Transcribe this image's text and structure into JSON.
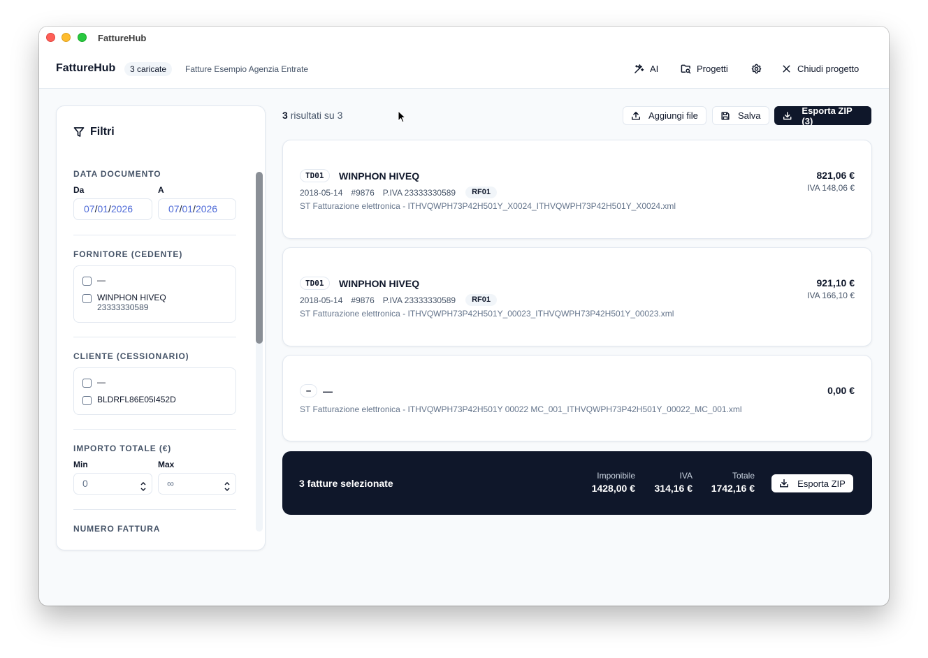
{
  "window": {
    "title": "FattureHub"
  },
  "header": {
    "brand": "FattureHub",
    "loaded_badge": "3 caricate",
    "project_name": "Fatture Esempio Agenzia Entrate",
    "ai_label": "AI",
    "projects_label": "Progetti",
    "close_project_label": "Chiudi progetto"
  },
  "sidebar": {
    "title": "Filtri",
    "date_section": {
      "title": "DATA DOCUMENTO",
      "from_label": "Da",
      "to_label": "A",
      "from": {
        "day": "07",
        "month": "01",
        "year": "2026"
      },
      "to": {
        "day": "07",
        "month": "01",
        "year": "2026"
      }
    },
    "supplier_section": {
      "title": "FORNITORE (CEDENTE)",
      "options": [
        {
          "label": "—",
          "sub": ""
        },
        {
          "label": "WINPHON HIVEQ",
          "sub": "23333330589"
        }
      ]
    },
    "client_section": {
      "title": "CLIENTE (CESSIONARIO)",
      "options": [
        {
          "label": "—"
        },
        {
          "label": "BLDRFL86E05I452D"
        }
      ]
    },
    "amount_section": {
      "title": "IMPORTO TOTALE (€)",
      "min_label": "Min",
      "max_label": "Max",
      "min_placeholder": "0",
      "max_placeholder": "∞"
    },
    "number_section": {
      "title": "NUMERO FATTURA"
    }
  },
  "results": {
    "count_shown": "3",
    "count_text": "risultati su 3",
    "add_files_label": "Aggiungi file",
    "save_label": "Salva",
    "export_zip_label": "Esporta ZIP (3)"
  },
  "invoices": [
    {
      "doc_type": "TD01",
      "supplier": "WINPHON HIVEQ",
      "date": "2018-05-14",
      "number": "#9876",
      "vat_id": "P.IVA 23333330589",
      "regime": "RF01",
      "file": "ST Fatturazione elettronica - ITHVQWPH73P42H501Y_X0024_ITHVQWPH73P42H501Y_X0024.xml",
      "amount": "821,06 €",
      "vat": "IVA 148,06 €"
    },
    {
      "doc_type": "TD01",
      "supplier": "WINPHON HIVEQ",
      "date": "2018-05-14",
      "number": "#9876",
      "vat_id": "P.IVA 23333330589",
      "regime": "RF01",
      "file": "ST Fatturazione elettronica - ITHVQWPH73P42H501Y_00023_ITHVQWPH73P42H501Y_00023.xml",
      "amount": "921,10 €",
      "vat": "IVA 166,10 €"
    },
    {
      "doc_type": "–",
      "supplier": "—",
      "file": "ST Fatturazione elettronica - ITHVQWPH73P42H501Y 00022 MC_001_ITHVQWPH73P42H501Y_00022_MC_001.xml",
      "amount": "0,00 €"
    }
  ],
  "summary": {
    "title": "3 fatture selezionate",
    "taxable_label": "Imponibile",
    "taxable_value": "1428,00 €",
    "vat_label": "IVA",
    "vat_value": "314,16 €",
    "total_label": "Totale",
    "total_value": "1742,16 €",
    "export_label": "Esporta ZIP"
  },
  "colors": {
    "primary_dark": "#0f172a",
    "date_accent": "#4f6bd8",
    "border": "#e2e8f0",
    "muted_text": "#475569"
  }
}
